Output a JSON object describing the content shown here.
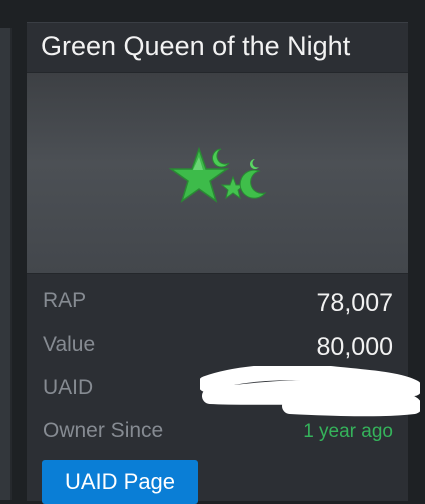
{
  "card": {
    "title": "Green Queen of the Night",
    "image_icon": "green-stars-and-moons-icon"
  },
  "stats": {
    "rap": {
      "label": "RAP",
      "value": "78,007"
    },
    "value": {
      "label": "Value",
      "value": "80,000"
    },
    "uaid": {
      "label": "UAID",
      "value": ""
    },
    "owner_since": {
      "label": "Owner Since",
      "value": "1 year ago"
    }
  },
  "button": {
    "label": "UAID Page"
  },
  "colors": {
    "background": "#1e2124",
    "card": "#2c2f34",
    "label": "#868b92",
    "value": "#f1f1f1",
    "positive": "#35b35b",
    "button": "#0a7ed6"
  }
}
